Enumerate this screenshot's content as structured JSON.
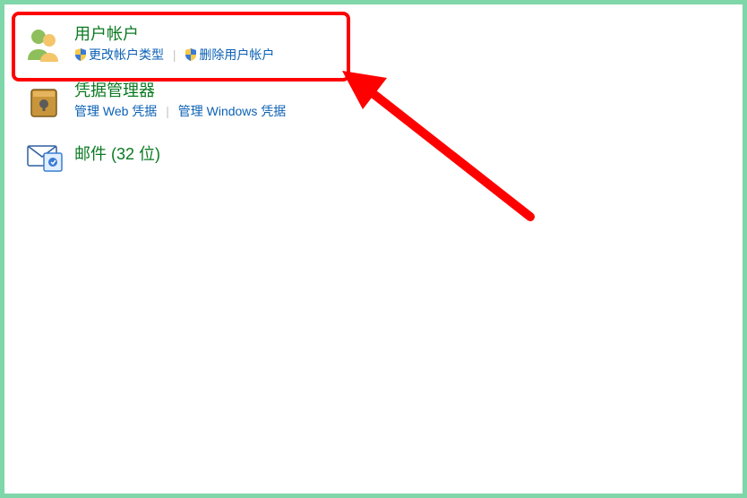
{
  "categories": {
    "accounts": {
      "title": "用户帐户",
      "links": {
        "change_type": "更改帐户类型",
        "remove_account": "删除用户帐户"
      }
    },
    "credentials": {
      "title": "凭据管理器",
      "links": {
        "manage_web": "管理 Web 凭据",
        "manage_windows": "管理 Windows 凭据"
      }
    },
    "mail": {
      "title": "邮件 (32 位)"
    }
  }
}
